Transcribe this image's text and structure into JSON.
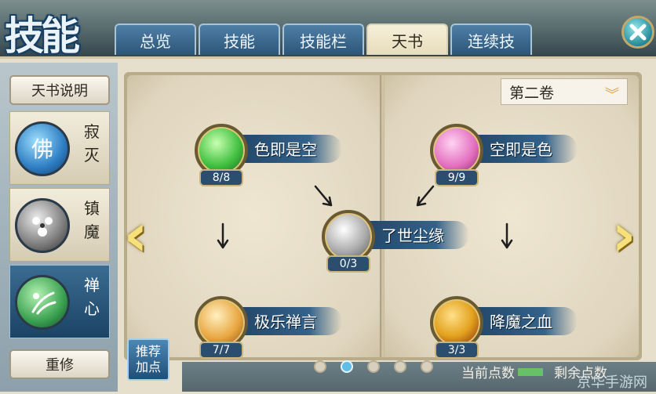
{
  "header": {
    "title": "技能",
    "tabs": [
      {
        "label": "总览",
        "active": false
      },
      {
        "label": "技能",
        "active": false
      },
      {
        "label": "技能栏",
        "active": false
      },
      {
        "label": "天书",
        "active": true
      },
      {
        "label": "连续技",
        "active": false
      }
    ]
  },
  "sidebar": {
    "description_button": "天书说明",
    "categories": [
      {
        "label": "寂灭",
        "icon": "buddha-icon",
        "active": false
      },
      {
        "label": "镇魔",
        "icon": "demon-seal-icon",
        "active": false
      },
      {
        "label": "禅心",
        "icon": "zen-heart-icon",
        "active": true
      }
    ],
    "reset_button": "重修"
  },
  "book": {
    "volume": "第二卷",
    "skills": [
      {
        "name": "色即是空",
        "count": "8/8",
        "color": "#3fbf3f",
        "icon": "green-orb-icon"
      },
      {
        "name": "空即是色",
        "count": "9/9",
        "color": "#e36fbf",
        "icon": "pink-orb-icon"
      },
      {
        "name": "了世尘缘",
        "count": "0/3",
        "color": "#a8a8a8",
        "icon": "silver-orb-icon"
      },
      {
        "name": "极乐禅言",
        "count": "7/7",
        "color": "#e8a640",
        "icon": "gold-orb-icon"
      },
      {
        "name": "降魔之血",
        "count": "3/3",
        "color": "#e2a11d",
        "icon": "blood-rune-icon"
      }
    ]
  },
  "recommend_button": "推荐加点",
  "pagination": {
    "count": 5,
    "active_index": 1
  },
  "points": {
    "current_label": "当前点数",
    "remaining_label": "剩余点数"
  },
  "watermark": "京华手游网"
}
